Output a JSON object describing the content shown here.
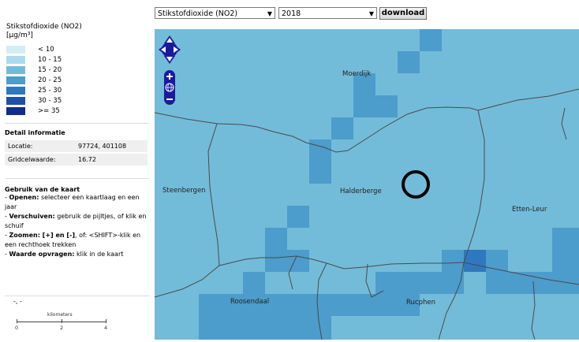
{
  "controls": {
    "pollutant_select": "Stikstofdioxide (NO2)",
    "year_select": "2018",
    "download_label": "download"
  },
  "legend": {
    "title_line1": "Stikstofdioxide (NO2)",
    "title_line2": "[µg/m³]",
    "classes": [
      {
        "label": "< 10",
        "color": "#d2edf6"
      },
      {
        "label": "10 - 15",
        "color": "#a8dcee"
      },
      {
        "label": "15 - 20",
        "color": "#73bcd9"
      },
      {
        "label": "20 - 25",
        "color": "#4c9ccc"
      },
      {
        "label": "25 - 30",
        "color": "#2f78bf"
      },
      {
        "label": "30 - 35",
        "color": "#1f50a8"
      },
      {
        "label": ">= 35",
        "color": "#112c8c"
      }
    ]
  },
  "detail": {
    "heading": "Detail informatie",
    "location_label": "Locatie:",
    "location_value": "97724, 401108",
    "grid_label": "Gridcelwaarde:",
    "grid_value": "16.72"
  },
  "help": {
    "heading": "Gebruik van de kaart",
    "items": [
      {
        "bold": "Openen:",
        "text": "selecteer een kaartlaag en een jaar"
      },
      {
        "bold": "Verschuiven:",
        "text": "gebruik de pijltjes, of klik en schuif"
      },
      {
        "bold": "Zoomen: [+] en [-]",
        "text": ", of: <SHIFT>-klik en een rechthoek trekken"
      },
      {
        "bold": "Waarde opvragen:",
        "text": "klik in de kaart"
      }
    ]
  },
  "cursor_coords": "-, -",
  "scalebar": {
    "caption": "kilometers",
    "labels": [
      "0",
      "2",
      "4"
    ]
  },
  "map": {
    "places": [
      "Moerdijk",
      "Steenbergen",
      "Halderberge",
      "Etten-Leur",
      "Roosendaal",
      "Rucphen"
    ],
    "navigation": [
      "pan-arrows",
      "zoom-in",
      "globe",
      "zoom-out"
    ]
  }
}
